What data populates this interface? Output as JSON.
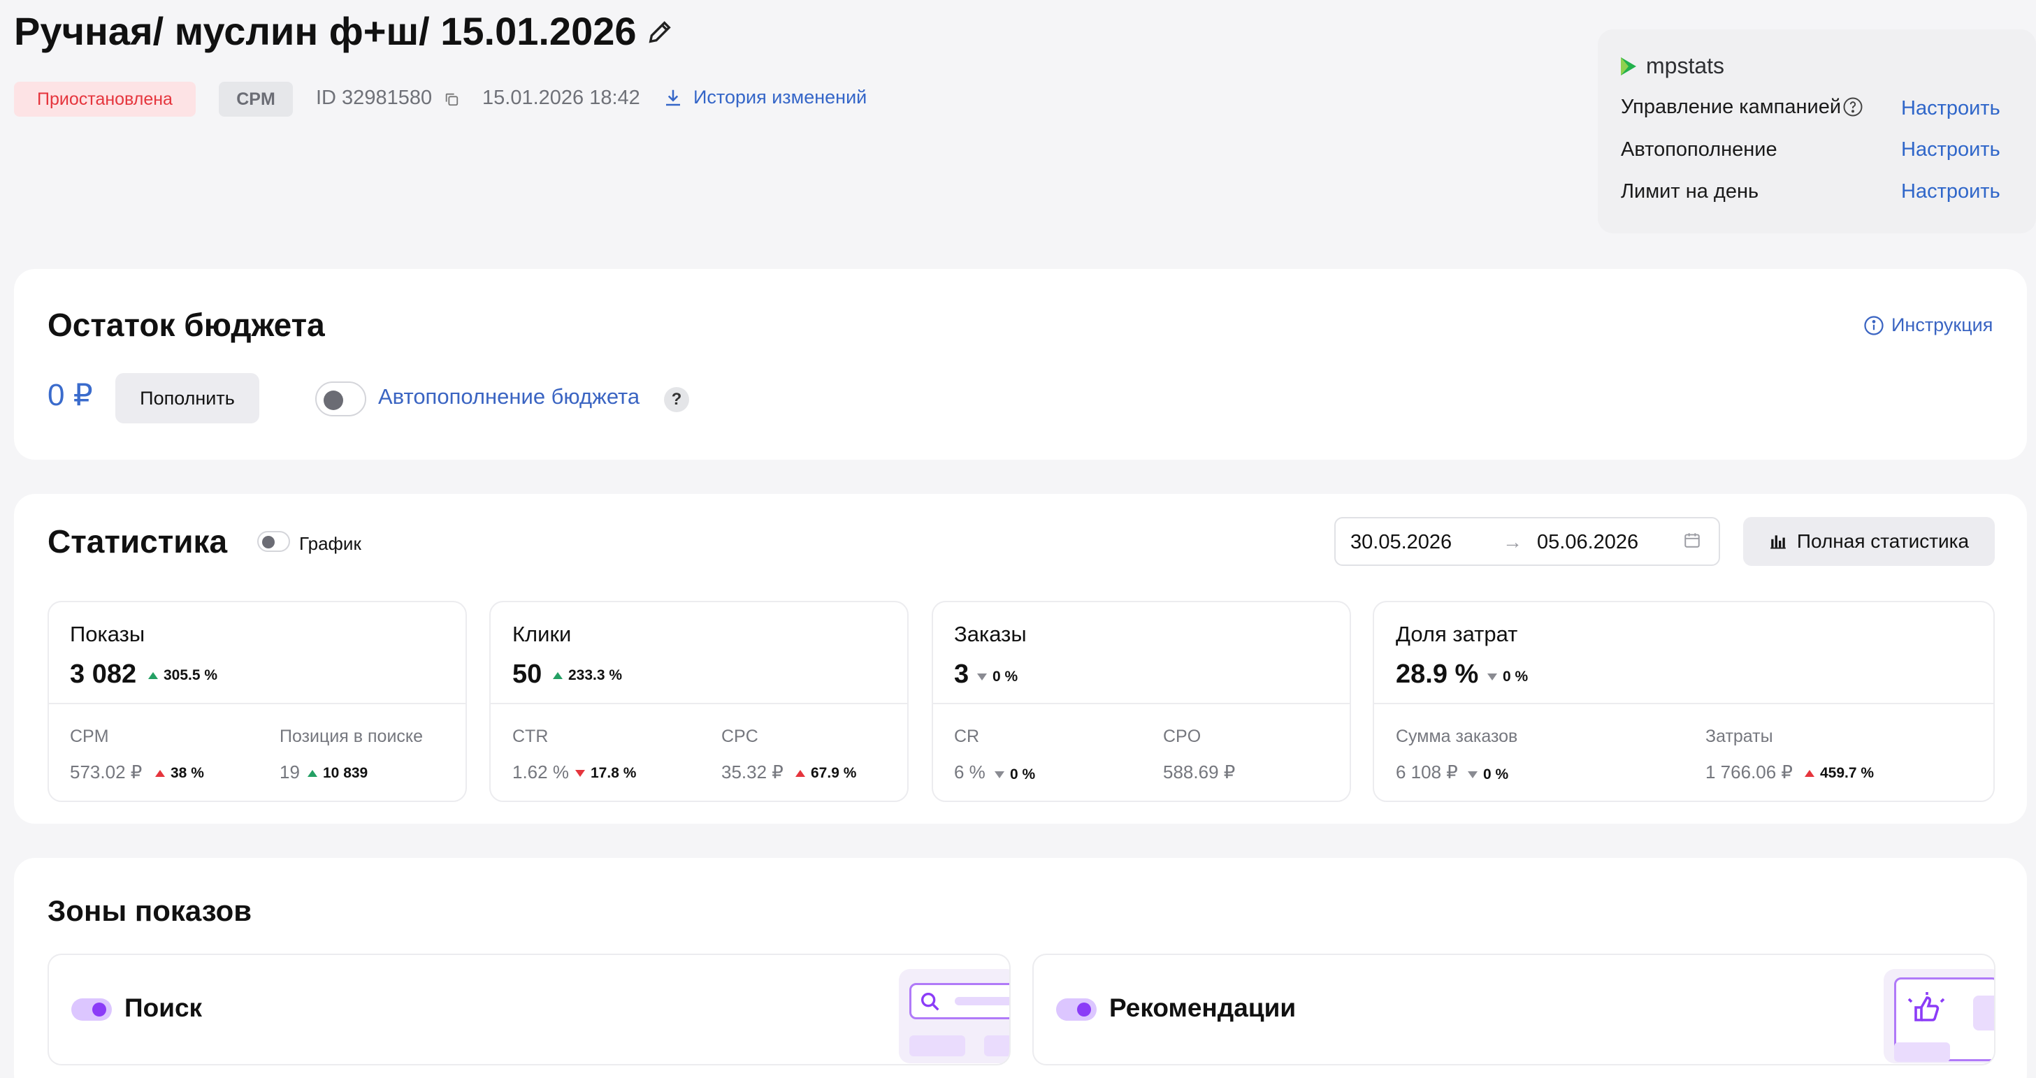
{
  "header": {
    "title": "Ручная/ муслин ф+ш/ 15.01.2026",
    "status": "Приостановлена",
    "type": "CPM",
    "id_text": "ID 32981580",
    "datetime": "15.01.2026 18:42",
    "history_link": "История изменений"
  },
  "mpstats": {
    "brand": "mpstats",
    "rows": [
      {
        "label": "Управление кампанией",
        "link": "Настроить"
      },
      {
        "label": "Автопополнение",
        "link": "Настроить"
      },
      {
        "label": "Лимит на день",
        "link": "Настроить"
      }
    ]
  },
  "budget": {
    "title": "Остаток бюджета",
    "amount": "0 ₽",
    "topup_button": "Пополнить",
    "auto_topup_label": "Автопополнение бюджета",
    "auto_topup_enabled": false,
    "help_mark": "?",
    "instruction_link": "Инструкция"
  },
  "stats": {
    "title": "Статистика",
    "graph_label": "График",
    "graph_enabled": false,
    "date_from": "30.05.2026",
    "date_arrow": "→",
    "date_to": "05.06.2026",
    "full_stats_button": "Полная статистика",
    "cards": [
      {
        "title": "Показы",
        "value": "3 082",
        "delta": "305.5 %",
        "delta_dir": "up-green",
        "subs": [
          {
            "label": "CPM",
            "value": "573.02 ₽",
            "delta": "38 %",
            "delta_dir": "up-red"
          },
          {
            "label": "Позиция в поиске",
            "value": "19",
            "delta": "10 839",
            "delta_dir": "up-green"
          }
        ]
      },
      {
        "title": "Клики",
        "value": "50",
        "delta": "233.3 %",
        "delta_dir": "up-green",
        "subs": [
          {
            "label": "CTR",
            "value": "1.62 %",
            "delta": "17.8 %",
            "delta_dir": "down-red"
          },
          {
            "label": "CPC",
            "value": "35.32 ₽",
            "delta": "67.9 %",
            "delta_dir": "up-red"
          }
        ]
      },
      {
        "title": "Заказы",
        "value": "3",
        "delta": "0 %",
        "delta_dir": "down-grey",
        "subs": [
          {
            "label": "CR",
            "value": "6 %",
            "delta": "0 %",
            "delta_dir": "down-grey"
          },
          {
            "label": "CPO",
            "value": "588.69 ₽",
            "delta": "",
            "delta_dir": ""
          }
        ]
      },
      {
        "title": "Доля затрат",
        "value": "28.9 %",
        "delta": "0 %",
        "delta_dir": "down-grey",
        "subs": [
          {
            "label": "Сумма заказов",
            "value": "6 108 ₽",
            "delta": "0 %",
            "delta_dir": "down-grey"
          },
          {
            "label": "Затраты",
            "value": "1 766.06 ₽",
            "delta": "459.7 %",
            "delta_dir": "up-red"
          }
        ]
      }
    ]
  },
  "zones": {
    "title": "Зоны показов",
    "items": [
      {
        "label": "Поиск",
        "enabled": true,
        "icon": "search-icon"
      },
      {
        "label": "Рекомендации",
        "enabled": true,
        "icon": "thumbs-up-icon"
      }
    ]
  },
  "colors": {
    "accent_blue": "#3566c8",
    "status_red": "#e5353d",
    "up_green": "#24a064",
    "toggle_purple": "#8b3cf7",
    "background": "#f5f5f7"
  }
}
